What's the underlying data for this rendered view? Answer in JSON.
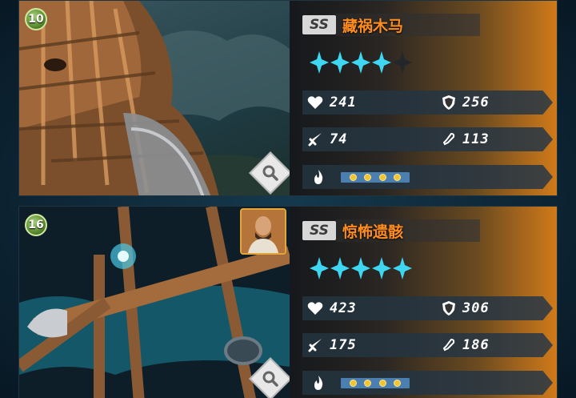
{
  "colors": {
    "accent_orange": "#ff8c1e",
    "star_cyan": "#3fd6f2",
    "talent_bar": "#4b7fb0",
    "talent_dot": "#f3c431"
  },
  "cards": [
    {
      "level": "10",
      "grade": "SS",
      "name": "藏祸木马",
      "stars": {
        "filled": 4,
        "total": 5
      },
      "hp": "241",
      "defense": "256",
      "attack": "74",
      "speed": "113",
      "talent_dots": 4,
      "has_portrait": false
    },
    {
      "level": "16",
      "grade": "SS",
      "name": "惊怖遗骸",
      "stars": {
        "filled": 5,
        "total": 5
      },
      "hp": "423",
      "defense": "306",
      "attack": "175",
      "speed": "186",
      "talent_dots": 4,
      "has_portrait": true
    }
  ]
}
